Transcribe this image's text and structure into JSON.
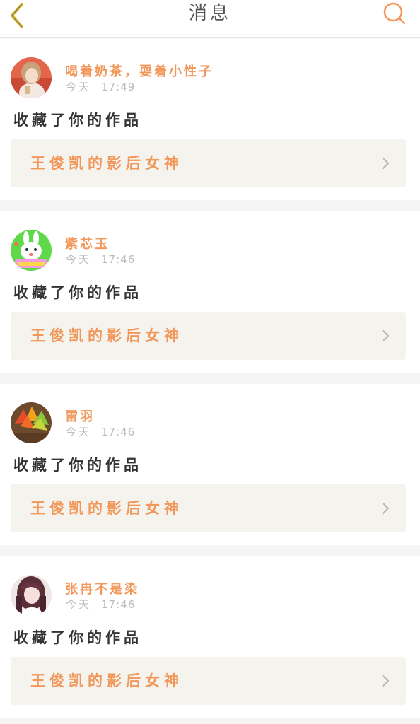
{
  "header": {
    "title": "消息",
    "back_icon": "chevron-left-icon",
    "search_icon": "search-icon",
    "accent_color": "#f2975a",
    "back_color": "#d8b63a"
  },
  "messages": [
    {
      "username": "喝着奶茶，耍着小性子",
      "day": "今天",
      "time": "17:49",
      "action": "收藏了你的作品",
      "work_title": "王俊凯的影后女神",
      "avatar": "avatar-girl-photo"
    },
    {
      "username": "紫芯玉",
      "day": "今天",
      "time": "17:46",
      "action": "收藏了你的作品",
      "work_title": "王俊凯的影后女神",
      "avatar": "avatar-bunny-cartoon"
    },
    {
      "username": "雷羽",
      "day": "今天",
      "time": "17:46",
      "action": "收藏了你的作品",
      "work_title": "王俊凯的影后女神",
      "avatar": "avatar-autumn-leaves"
    },
    {
      "username": "张冉不是染",
      "day": "今天",
      "time": "17:46",
      "action": "收藏了你的作品",
      "work_title": "王俊凯的影后女神",
      "avatar": "avatar-anime-girl"
    }
  ]
}
